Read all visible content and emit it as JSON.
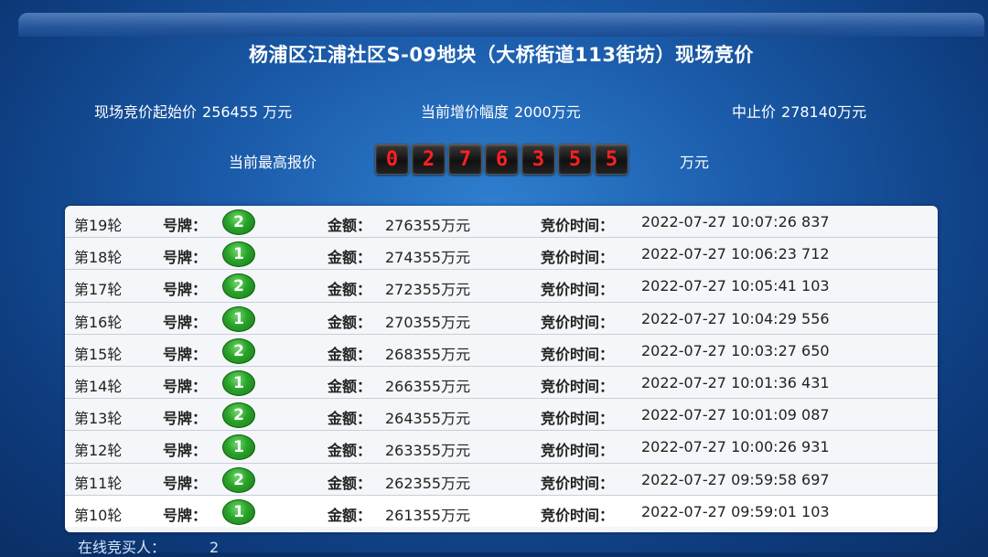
{
  "title": "杨浦区江浦社区S-09地块（大桥街道113街坊）现场竞价",
  "info": {
    "start_label": "现场竞价起始价",
    "start_value": "256455 万元",
    "increment_label": "当前增价幅度",
    "increment_value": "2000万元",
    "cap_label": "中止价",
    "cap_value": "278140万元"
  },
  "highest_bid": {
    "label": "当前最高报价",
    "digits": [
      "0",
      "2",
      "7",
      "6",
      "3",
      "5",
      "5"
    ],
    "unit": "万元"
  },
  "bids": [
    {
      "round": "第19轮",
      "paddle_label": "号牌：",
      "paddle": "2",
      "amount_label": "金额：",
      "amount": "276355万元",
      "time_label": "竞价时间：",
      "time": "2022-07-27 10:07:26 837"
    },
    {
      "round": "第18轮",
      "paddle_label": "号牌：",
      "paddle": "1",
      "amount_label": "金额：",
      "amount": "274355万元",
      "time_label": "竞价时间：",
      "time": "2022-07-27 10:06:23 712"
    },
    {
      "round": "第17轮",
      "paddle_label": "号牌：",
      "paddle": "2",
      "amount_label": "金额：",
      "amount": "272355万元",
      "time_label": "竞价时间：",
      "time": "2022-07-27 10:05:41 103"
    },
    {
      "round": "第16轮",
      "paddle_label": "号牌：",
      "paddle": "1",
      "amount_label": "金额：",
      "amount": "270355万元",
      "time_label": "竞价时间：",
      "time": "2022-07-27 10:04:29 556"
    },
    {
      "round": "第15轮",
      "paddle_label": "号牌：",
      "paddle": "2",
      "amount_label": "金额：",
      "amount": "268355万元",
      "time_label": "竞价时间：",
      "time": "2022-07-27 10:03:27 650"
    },
    {
      "round": "第14轮",
      "paddle_label": "号牌：",
      "paddle": "1",
      "amount_label": "金额：",
      "amount": "266355万元",
      "time_label": "竞价时间：",
      "time": "2022-07-27 10:01:36 431"
    },
    {
      "round": "第13轮",
      "paddle_label": "号牌：",
      "paddle": "2",
      "amount_label": "金额：",
      "amount": "264355万元",
      "time_label": "竞价时间：",
      "time": "2022-07-27 10:01:09 087"
    },
    {
      "round": "第12轮",
      "paddle_label": "号牌：",
      "paddle": "1",
      "amount_label": "金额：",
      "amount": "263355万元",
      "time_label": "竞价时间：",
      "time": "2022-07-27 10:00:26 931"
    },
    {
      "round": "第11轮",
      "paddle_label": "号牌：",
      "paddle": "2",
      "amount_label": "金额：",
      "amount": "262355万元",
      "time_label": "竞价时间：",
      "time": "2022-07-27 09:59:58 697"
    },
    {
      "round": "第10轮",
      "paddle_label": "号牌：",
      "paddle": "1",
      "amount_label": "金额：",
      "amount": "261355万元",
      "time_label": "竞价时间：",
      "time": "2022-07-27 09:59:01 103"
    }
  ],
  "online": {
    "label": "在线竞买人：",
    "value": "2"
  },
  "colors": {
    "background": "#1a5aa8",
    "digit_text": "#ff2020",
    "paddle_badge": "#2aa22a",
    "panel": "#f4f6f9"
  }
}
